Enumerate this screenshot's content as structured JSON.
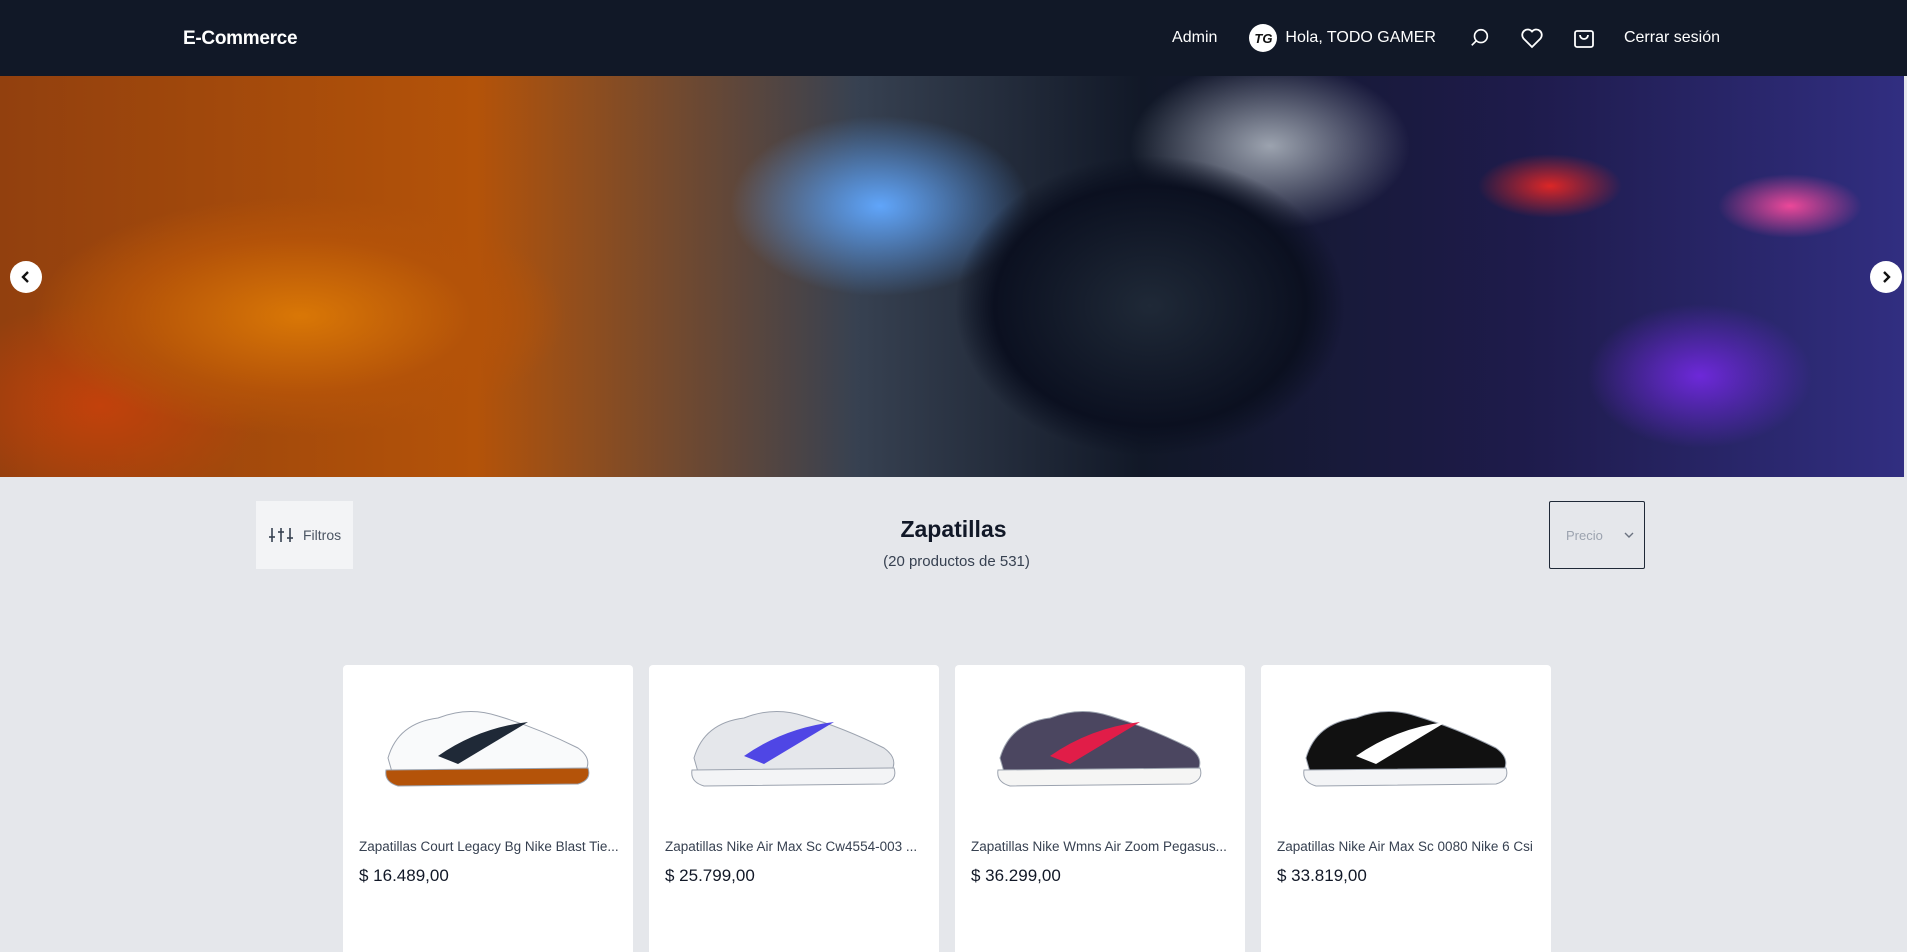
{
  "navbar": {
    "brand": "E-Commerce",
    "admin_label": "Admin",
    "user_initials": "TG",
    "user_greeting": "Hola, TODO GAMER",
    "logout_label": "Cerrar sesión"
  },
  "catalog": {
    "filters_label": "Filtros",
    "title": "Zapatillas",
    "count_text": "(20 productos de 531)",
    "sort_placeholder": "Precio"
  },
  "products": [
    {
      "name": "Zapatillas Court Legacy Bg Nike Blast Tie...",
      "price": "$ 16.489,00",
      "colors": {
        "upper": "#f9fafb",
        "accent": "#1f2937",
        "sole": "#b45309"
      }
    },
    {
      "name": "Zapatillas Nike Air Max Sc Cw4554-003 ...",
      "price": "$ 25.799,00",
      "colors": {
        "upper": "#e5e7eb",
        "accent": "#4f46e5",
        "sole": "#f3f4f6"
      }
    },
    {
      "name": "Zapatillas Nike Wmns Air Zoom Pegasus...",
      "price": "$ 36.299,00",
      "colors": {
        "upper": "#4b4660",
        "accent": "#e11d48",
        "sole": "#f5f5f4"
      }
    },
    {
      "name": "Zapatillas Nike Air Max Sc 0080 Nike 6 Csi",
      "price": "$ 33.819,00",
      "colors": {
        "upper": "#111111",
        "accent": "#ffffff",
        "sole": "#f3f4f6"
      }
    }
  ]
}
